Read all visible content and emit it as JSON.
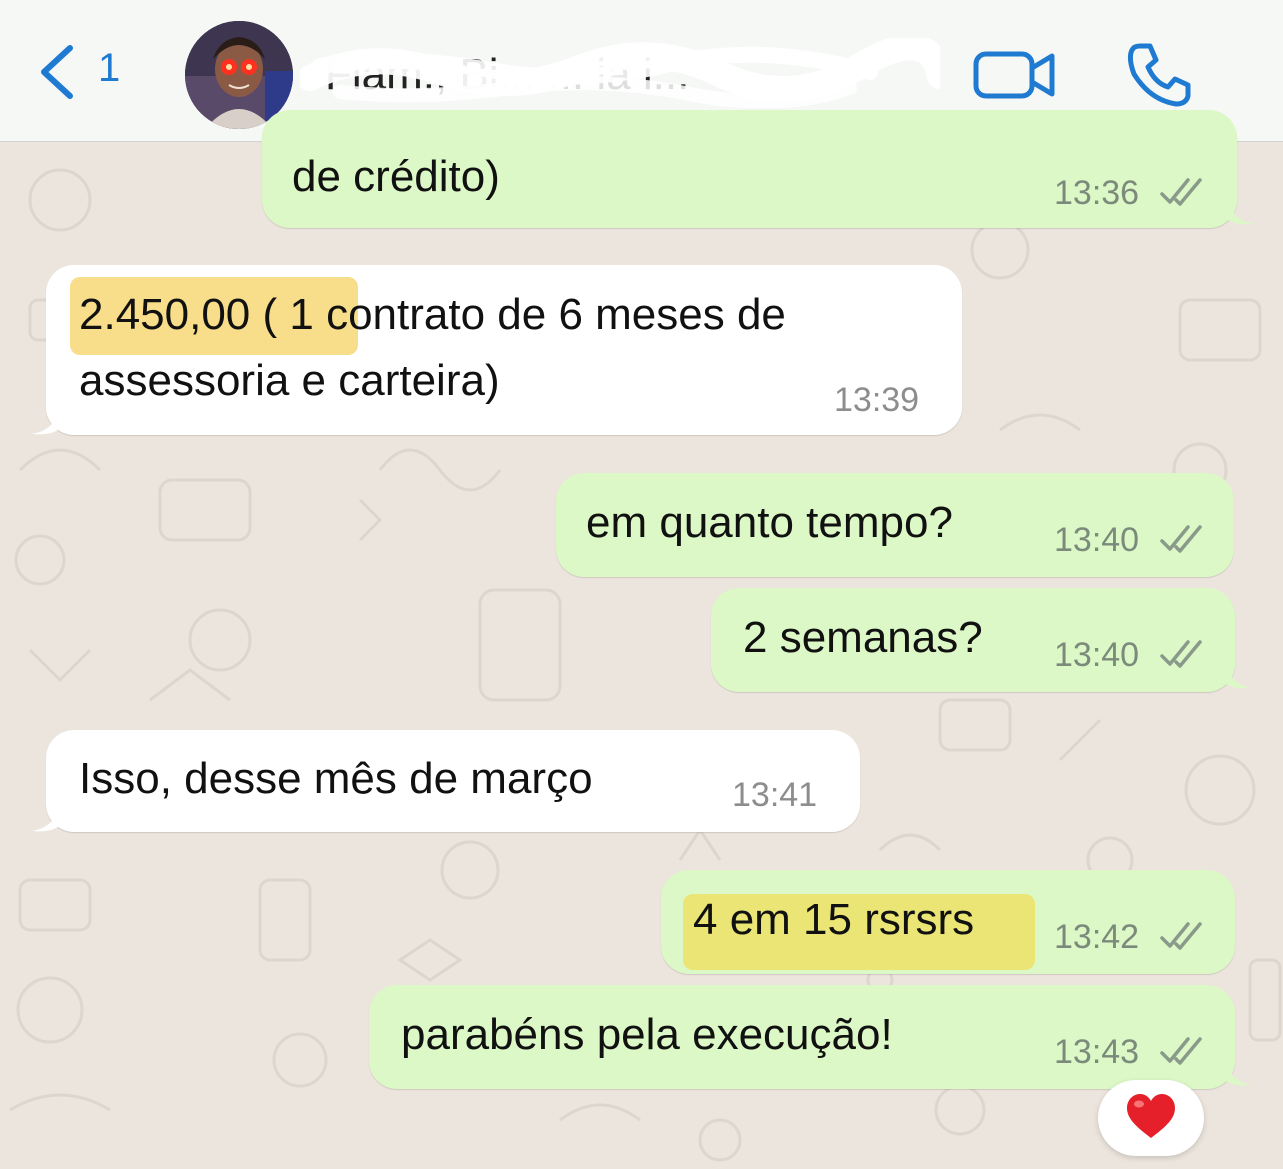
{
  "header": {
    "back_count": "1",
    "contact_name": "Fiam., Bi... ... ia l..."
  },
  "messages": [
    {
      "direction": "out",
      "text_lines": [
        "de crédito)"
      ],
      "time": "13:36",
      "status": "read"
    },
    {
      "direction": "in",
      "text_lines": [
        "2.450,00 ( 1 contrato de 6 meses de",
        "assessoria e carteira)"
      ],
      "time": "13:39",
      "highlighted_text": "2.450,00 ( 1"
    },
    {
      "direction": "out",
      "text_lines": [
        "em quanto tempo?"
      ],
      "time": "13:40",
      "status": "read"
    },
    {
      "direction": "out",
      "text_lines": [
        "2 semanas?"
      ],
      "time": "13:40",
      "status": "read"
    },
    {
      "direction": "in",
      "text_lines": [
        "Isso, desse mês de março"
      ],
      "time": "13:41"
    },
    {
      "direction": "out",
      "text_lines": [
        "4 em 15 rsrsrs"
      ],
      "time": "13:42",
      "status": "read",
      "highlighted_text": "4 em 15 rsrsrs"
    },
    {
      "direction": "out",
      "text_lines": [
        "parabéns pela execução!"
      ],
      "time": "13:43",
      "status": "read"
    }
  ],
  "reaction": {
    "emoji_name": "red-heart"
  },
  "colors": {
    "accent": "#1f7bd1",
    "outgoing_bubble": "#dcf8c6",
    "incoming_bubble": "#ffffff",
    "chat_background": "#ece5dd",
    "highlight": "#f5d65a",
    "read_ticks": "#8a9a8a"
  }
}
